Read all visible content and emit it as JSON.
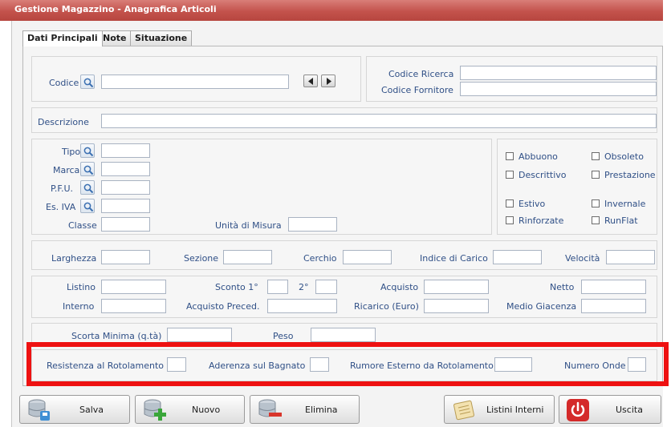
{
  "window": {
    "title": "Gestione Magazzino - Anagrafica Articoli"
  },
  "tabs": [
    {
      "label": "Dati Principali",
      "active": true
    },
    {
      "label": "Note",
      "active": false
    },
    {
      "label": "Situazione",
      "active": false
    }
  ],
  "codice": {
    "label": "Codice",
    "value": "",
    "codice_ricerca_label": "Codice Ricerca",
    "codice_ricerca_value": "",
    "codice_fornitore_label": "Codice Fornitore",
    "codice_fornitore_value": ""
  },
  "descrizione": {
    "label": "Descrizione",
    "value": ""
  },
  "anagrafica": {
    "tipo_label": "Tipo",
    "marca_label": "Marca",
    "pfu_label": "P.F.U.",
    "es_iva_label": "Es. IVA",
    "classe_label": "Classe",
    "unita_misura_label": "Unità di Misura"
  },
  "flags": {
    "abbuono": "Abbuono",
    "obsoleto": "Obsoleto",
    "descrittivo": "Descrittivo",
    "prestazione": "Prestazione",
    "estivo": "Estivo",
    "invernale": "Invernale",
    "rinforzate": "Rinforzate",
    "runflat": "RunFlat"
  },
  "misure": {
    "larghezza": "Larghezza",
    "sezione": "Sezione",
    "cerchio": "Cerchio",
    "indice_carico": "Indice di Carico",
    "velocita": "Velocità"
  },
  "prezzi": {
    "listino": "Listino",
    "sconto1": "Sconto 1°",
    "sconto2": "2°",
    "acquisto": "Acquisto",
    "netto": "Netto",
    "interno": "Interno",
    "acquisto_preced": "Acquisto Preced.",
    "ricarico": "Ricarico (Euro)",
    "medio_giacenza": "Medio Giacenza"
  },
  "scorte": {
    "scorta_minima": "Scorta Minima (q.tà)",
    "peso": "Peso"
  },
  "etichetta": {
    "resistenza": "Resistenza al Rotolamento",
    "aderenza": "Aderenza sul Bagnato",
    "rumore": "Rumore Esterno da Rotolamento",
    "numero_onde": "Numero Onde"
  },
  "buttons": {
    "salva": "Salva",
    "nuovo": "Nuovo",
    "elimina": "Elimina",
    "listini_interni": "Listini Interni",
    "uscita": "Uscita"
  },
  "colors": {
    "title_bar": "#c3524c",
    "label": "#2f4f86",
    "highlight": "#ee1111",
    "uscita_icon": "#d42a2a"
  }
}
